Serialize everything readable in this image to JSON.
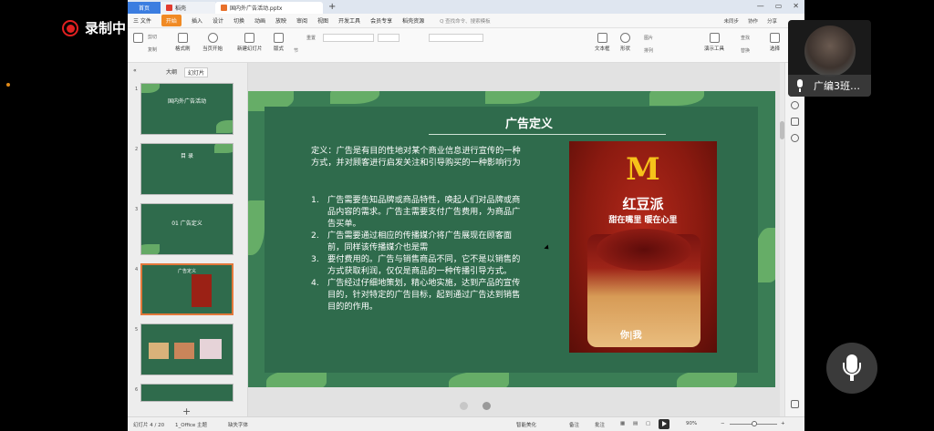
{
  "recording": {
    "label": "录制中"
  },
  "titlebar": {
    "tabs": [
      {
        "label": "首页"
      },
      {
        "label": "稻壳"
      },
      {
        "label": "国内外广告活动.pptx"
      }
    ],
    "new_tab": "+"
  },
  "menubar": {
    "items": [
      "三 文件",
      "开始",
      "插入",
      "设计",
      "切换",
      "动画",
      "放映",
      "审阅",
      "视图",
      "开发工具",
      "会员专享",
      "稻壳资源"
    ],
    "search_placeholder": "Q 查找命令、搜索模板",
    "right": [
      "未同步",
      "协作",
      "分享"
    ]
  },
  "ribbon": {
    "items": [
      "剪切",
      "复制",
      "格式刷",
      "当页开始",
      "新建幻灯片",
      "版式",
      "节",
      "重置",
      "文本框",
      "形状",
      "图片",
      "排列",
      "演示工具",
      "查找",
      "替换",
      "选择"
    ]
  },
  "outline_pane": {
    "tabs": [
      "大纲",
      "幻灯片"
    ],
    "slides": [
      {
        "num": "1",
        "title": "国内外广告活动"
      },
      {
        "num": "2",
        "title": "目 录"
      },
      {
        "num": "3",
        "title": "01 广告定义"
      },
      {
        "num": "4",
        "title": "广告定义"
      },
      {
        "num": "5",
        "title": ""
      },
      {
        "num": "6",
        "title": ""
      }
    ],
    "add": "+"
  },
  "slide": {
    "title": "广告定义",
    "definition": "定义：广告是有目的性地对某个商业信息进行宣传的一种方式，并对顾客进行启发关注和引导购买的一种影响行为",
    "items": [
      {
        "num": "1.",
        "text": "广告需要告知品牌或商品特性，唤起人们对品牌或商品内容的需求。广告主需要支付广告费用，为商品广告买单。"
      },
      {
        "num": "2.",
        "text": "广告需要通过相应的传播媒介将广告展现在顾客面前，同样该传播媒介也是需"
      },
      {
        "num": "3.",
        "text": "要付费用的。广告与销售商品不同，它不是以销售的方式获取利润，仅仅是商品的一种传播引导方式。"
      },
      {
        "num": "4.",
        "text": "广告经过仔细地策划，精心地实施，达到产品的宣传目的，针对特定的广告目标，起到通过广告达到销售目的的作用。"
      }
    ],
    "ad": {
      "logo": "M",
      "headline": "红豆派",
      "tagline": "甜在嘴里 暖在心里",
      "badge": "你|我"
    }
  },
  "statusbar": {
    "slide_info": "幻灯片 4 / 20",
    "theme": "1_Office 主题",
    "font_missing": "缺失字体",
    "smart_beautify": "智能美化",
    "notes": "备注",
    "comments": "批注",
    "zoom": "90%"
  },
  "participant": {
    "name": "广编3班…"
  },
  "colors": {
    "accent": "#f08a24",
    "slide_green": "#2f6b4c",
    "record_red": "#e02020"
  }
}
